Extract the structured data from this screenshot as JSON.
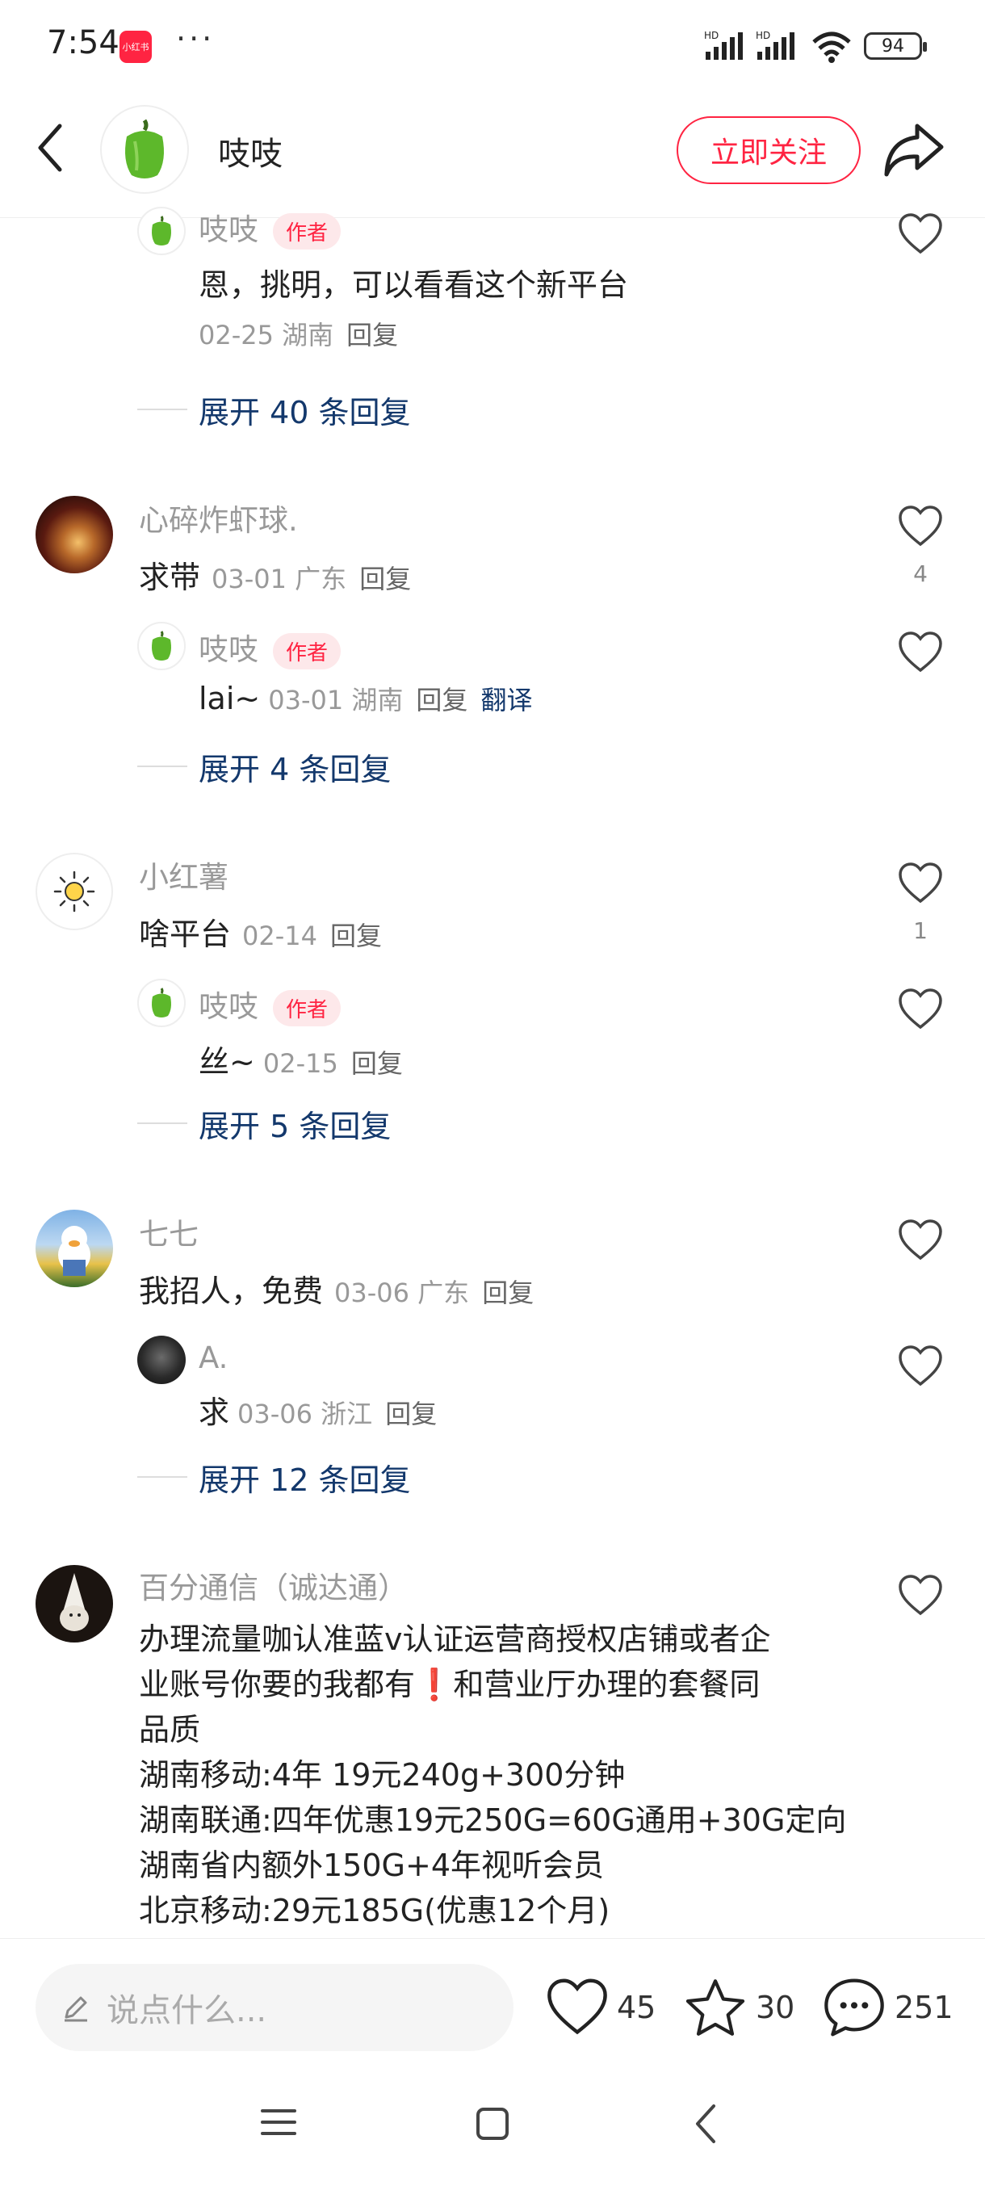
{
  "status_bar": {
    "time": "7:54",
    "app_badge": "小红书",
    "more": "···",
    "battery": "94"
  },
  "header": {
    "author_name": "吱吱",
    "follow_label": "立即关注"
  },
  "comments": [
    {
      "reply": {
        "name": "吱吱",
        "tag": "作者",
        "text": "恩，挑明，可以看看这个新平台",
        "date": "02-25",
        "location": "湖南",
        "reply_label": "回复"
      },
      "expand": "展开 40 条回复"
    },
    {
      "name": "心碎炸虾球.",
      "text": "求带",
      "date": "03-01",
      "location": "广东",
      "reply_label": "回复",
      "likes": "4",
      "reply": {
        "name": "吱吱",
        "tag": "作者",
        "text": "lai~",
        "date": "03-01",
        "location": "湖南",
        "reply_label": "回复",
        "translate": "翻译"
      },
      "expand": "展开 4 条回复"
    },
    {
      "name": "小红薯",
      "text": "啥平台",
      "date": "02-14",
      "location": "",
      "reply_label": "回复",
      "likes": "1",
      "reply": {
        "name": "吱吱",
        "tag": "作者",
        "text": "丝~",
        "date": "02-15",
        "reply_label": "回复"
      },
      "expand": "展开 5 条回复"
    },
    {
      "name": "七七",
      "text": "我招人，免费",
      "date": "03-06",
      "location": "广东",
      "reply_label": "回复",
      "reply": {
        "name": "A.",
        "text": "求",
        "date": "03-06",
        "location": "浙江",
        "reply_label": "回复"
      },
      "expand": "展开 12 条回复"
    },
    {
      "name": "百分通信（诚达通）",
      "text": "办理流量咖认准蓝v认证运营商授权店铺或者企\n业账号你要的我都有❗和营业厅办理的套餐同\n品质\n湖南移动:4年 19元240g+300分钟\n湖南联通:四年优惠19元250G=60G通用+30G定向\n湖南省内额外150G+4年视听会员\n北京移动:29元185G(优惠12个月)"
    }
  ],
  "bottom_bar": {
    "input_placeholder": "说点什么...",
    "likes": "45",
    "favorites": "30",
    "comments": "251"
  },
  "colors": {
    "accent": "#ff2442",
    "link": "#13386c"
  }
}
